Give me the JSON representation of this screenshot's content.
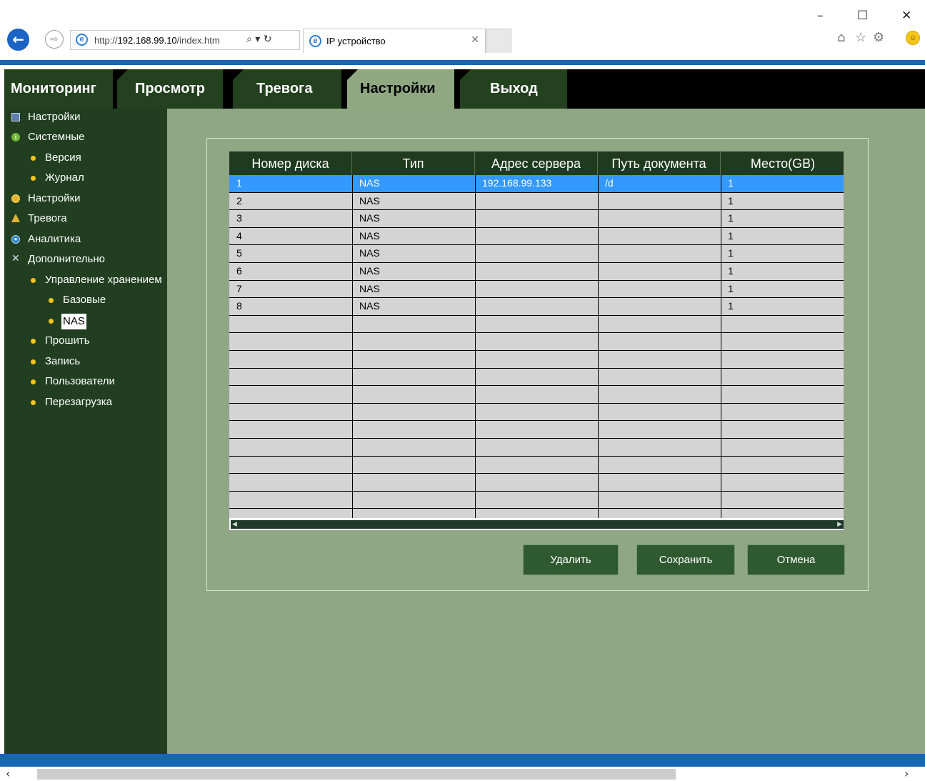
{
  "browser": {
    "window_controls": {
      "minimize": "–",
      "maximize": "☐",
      "close": "✕"
    },
    "back_glyph": "←",
    "forward_glyph": "⇨",
    "url_prefix": "http://",
    "url_host": "192.168.99.10",
    "url_path": "/index.htm",
    "addr_tools": "⌕ ▾ ↻",
    "tab_title": "IP устройство",
    "tab_close": "✕",
    "toolbar_icons": {
      "home": "⌂",
      "favorites": "☆",
      "settings": "⚙",
      "feedback": "☺"
    },
    "accent_color": "#1866b6"
  },
  "menu": {
    "tabs": [
      {
        "label": "Мониторинг",
        "active": false
      },
      {
        "label": "Просмотр",
        "active": false
      },
      {
        "label": "Тревога",
        "active": false
      },
      {
        "label": "Настройки",
        "active": true
      },
      {
        "label": "Выход",
        "active": false
      }
    ]
  },
  "sidebar": {
    "items": [
      {
        "label": "Настройки",
        "icon": "book-icon",
        "level": 0
      },
      {
        "label": "Системные",
        "icon": "info-icon",
        "level": 0
      },
      {
        "label": "Версия",
        "icon": "bullet-icon",
        "level": 1
      },
      {
        "label": "Журнал",
        "icon": "bullet-icon",
        "level": 1
      },
      {
        "label": "Настройки",
        "icon": "gear-icon",
        "level": 0
      },
      {
        "label": "Тревога",
        "icon": "bell-icon",
        "level": 0
      },
      {
        "label": "Аналитика",
        "icon": "globe-icon",
        "level": 0
      },
      {
        "label": "Дополнительно",
        "icon": "tools-icon",
        "level": 0
      },
      {
        "label": "Управление хранением",
        "icon": "bullet-icon",
        "level": 1
      },
      {
        "label": "Базовые",
        "icon": "bullet-icon",
        "level": 2
      },
      {
        "label": "NAS",
        "icon": "bullet-icon",
        "level": 2,
        "selected": true
      },
      {
        "label": "Прошить",
        "icon": "bullet-icon",
        "level": 1
      },
      {
        "label": "Запись",
        "icon": "bullet-icon",
        "level": 1
      },
      {
        "label": "Пользователи",
        "icon": "bullet-icon",
        "level": 1
      },
      {
        "label": "Перезагрузка",
        "icon": "bullet-icon",
        "level": 1
      }
    ]
  },
  "nas_table": {
    "columns": [
      "Номер диска",
      "Тип",
      "Адрес сервера",
      "Путь документа",
      "Место(GB)"
    ],
    "rows": [
      [
        "1",
        "NAS",
        "192.168.99.133",
        "/d",
        "1"
      ],
      [
        "2",
        "NAS",
        "",
        "",
        "1"
      ],
      [
        "3",
        "NAS",
        "",
        "",
        "1"
      ],
      [
        "4",
        "NAS",
        "",
        "",
        "1"
      ],
      [
        "5",
        "NAS",
        "",
        "",
        "1"
      ],
      [
        "6",
        "NAS",
        "",
        "",
        "1"
      ],
      [
        "7",
        "NAS",
        "",
        "",
        "1"
      ],
      [
        "8",
        "NAS",
        "",
        "",
        "1"
      ],
      [
        "",
        "",
        "",
        "",
        ""
      ],
      [
        "",
        "",
        "",
        "",
        ""
      ],
      [
        "",
        "",
        "",
        "",
        ""
      ],
      [
        "",
        "",
        "",
        "",
        ""
      ],
      [
        "",
        "",
        "",
        "",
        ""
      ],
      [
        "",
        "",
        "",
        "",
        ""
      ],
      [
        "",
        "",
        "",
        "",
        ""
      ],
      [
        "",
        "",
        "",
        "",
        ""
      ],
      [
        "",
        "",
        "",
        "",
        ""
      ],
      [
        "",
        "",
        "",
        "",
        ""
      ],
      [
        "",
        "",
        "",
        "",
        ""
      ]
    ],
    "selected_row": 0,
    "scroll_left_glyph": "◀",
    "scroll_right_glyph": "▶"
  },
  "buttons": {
    "delete": "Удалить",
    "save": "Сохранить",
    "cancel": "Отмена"
  },
  "page_scrollbar": {
    "left_glyph": "‹",
    "right_glyph": "›"
  },
  "colors": {
    "menu_bg": "#000000",
    "tab_bg": "#23401f",
    "tab_active_bg": "#8fa882",
    "sidebar_bg": "#213f20",
    "content_bg": "#8fa883",
    "grid_header_bg": "#203a1e",
    "grid_cell_bg": "#d4d4d4",
    "selection": "#3399ff",
    "button_bg": "#2f5a30"
  }
}
